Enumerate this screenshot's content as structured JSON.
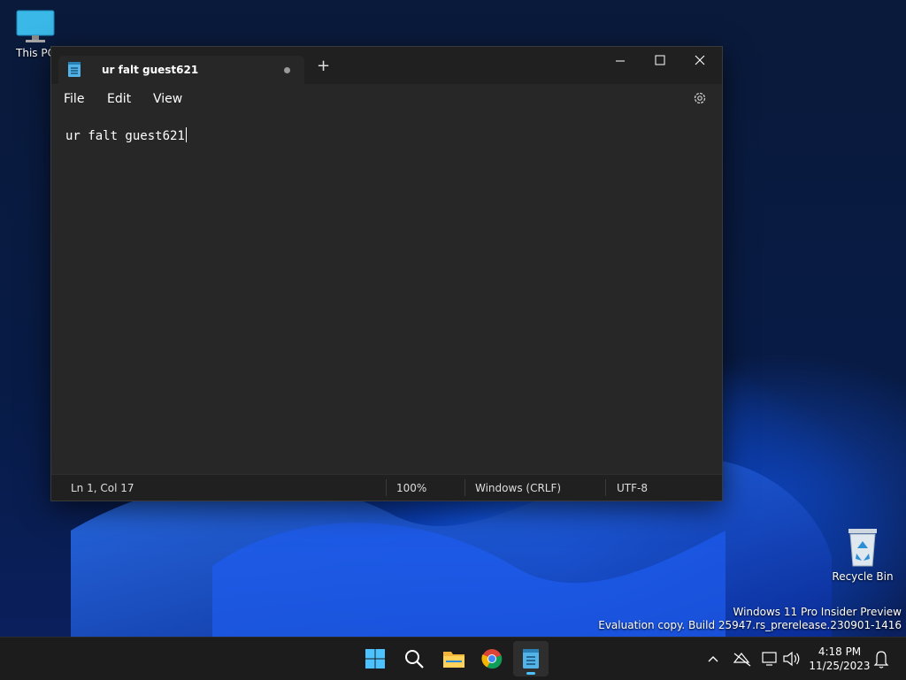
{
  "desktop": {
    "this_pc_label": "This PC",
    "recycle_bin_label": "Recycle Bin"
  },
  "notepad": {
    "tab_title": "ur falt guest621",
    "menu": {
      "file": "File",
      "edit": "Edit",
      "view": "View"
    },
    "content": "ur falt guest621",
    "status": {
      "position": "Ln 1, Col 17",
      "zoom": "100%",
      "line_ending": "Windows (CRLF)",
      "encoding": "UTF-8"
    }
  },
  "watermark": {
    "line1": "Windows 11 Pro Insider Preview",
    "line2": "Evaluation copy. Build 25947.rs_prerelease.230901-1416"
  },
  "taskbar": {
    "time": "4:18 PM",
    "date": "11/25/2023",
    "apps": [
      "start-icon",
      "search-icon",
      "file-explorer-icon",
      "chrome-icon",
      "notepad-icon"
    ]
  },
  "colors": {
    "accent": "#4cc2ff",
    "window_bg": "#272727",
    "titlebar_bg": "#202020"
  }
}
